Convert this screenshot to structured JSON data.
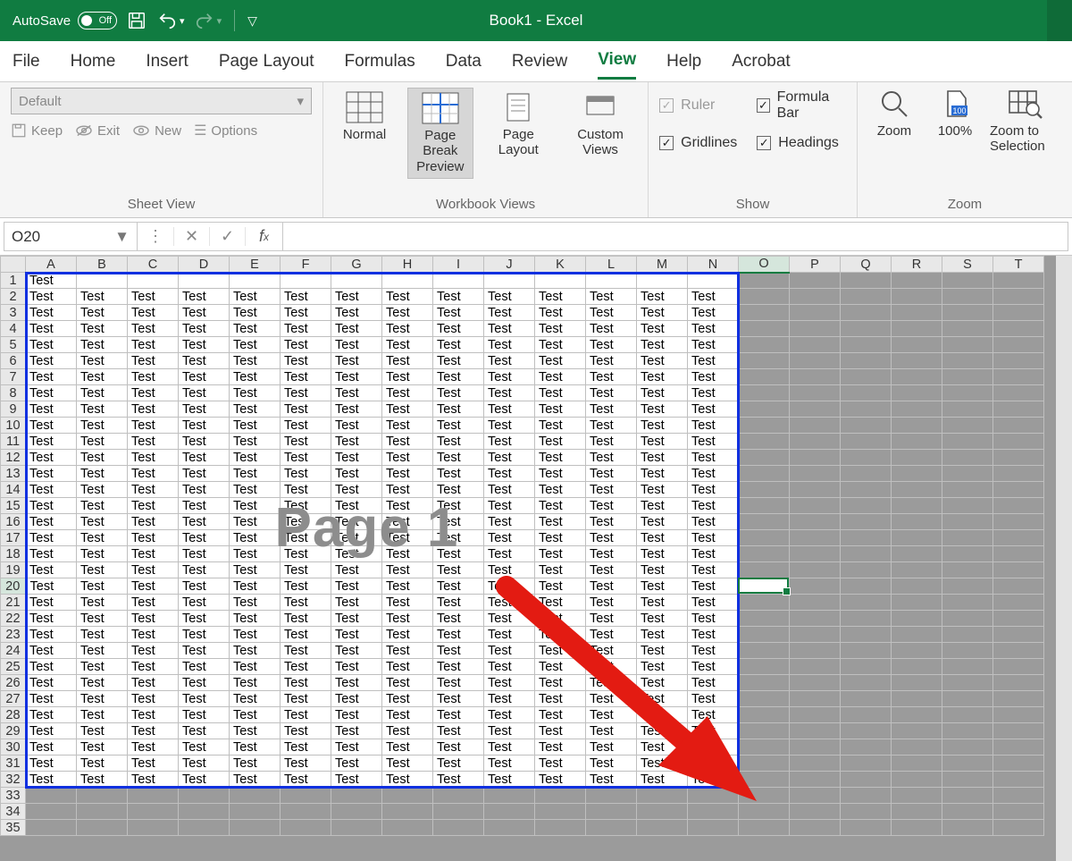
{
  "titlebar": {
    "autosave_label": "AutoSave",
    "autosave_state": "Off",
    "title": "Book1  -  Excel"
  },
  "tabs": [
    "File",
    "Home",
    "Insert",
    "Page Layout",
    "Formulas",
    "Data",
    "Review",
    "View",
    "Help",
    "Acrobat"
  ],
  "active_tab": "View",
  "ribbon": {
    "sheet_view": {
      "dropdown": "Default",
      "keep": "Keep",
      "exit": "Exit",
      "new": "New",
      "options": "Options",
      "group": "Sheet View"
    },
    "workbook_views": {
      "normal": "Normal",
      "page_break": "Page Break Preview",
      "page_layout": "Page Layout",
      "custom": "Custom Views",
      "group": "Workbook Views"
    },
    "show": {
      "ruler": "Ruler",
      "gridlines": "Gridlines",
      "formula_bar": "Formula Bar",
      "headings": "Headings",
      "group": "Show"
    },
    "zoom": {
      "zoom": "Zoom",
      "hundred": "100%",
      "to_sel": "Zoom to Selection",
      "group": "Zoom"
    }
  },
  "namebox": "O20",
  "columns": [
    "A",
    "B",
    "C",
    "D",
    "E",
    "F",
    "G",
    "H",
    "I",
    "J",
    "K",
    "L",
    "M",
    "N",
    "O",
    "P",
    "Q",
    "R",
    "S",
    "T"
  ],
  "data_cols": 14,
  "total_cols": 20,
  "total_rows": 35,
  "data_rows": 32,
  "first_row_single": true,
  "cell_text": "Test",
  "watermark": "Page 1",
  "active_cell": {
    "col": "O",
    "row": 20
  },
  "colors": {
    "brand": "#107c41",
    "page_border": "#1030e0",
    "arrow": "#e31b12"
  }
}
